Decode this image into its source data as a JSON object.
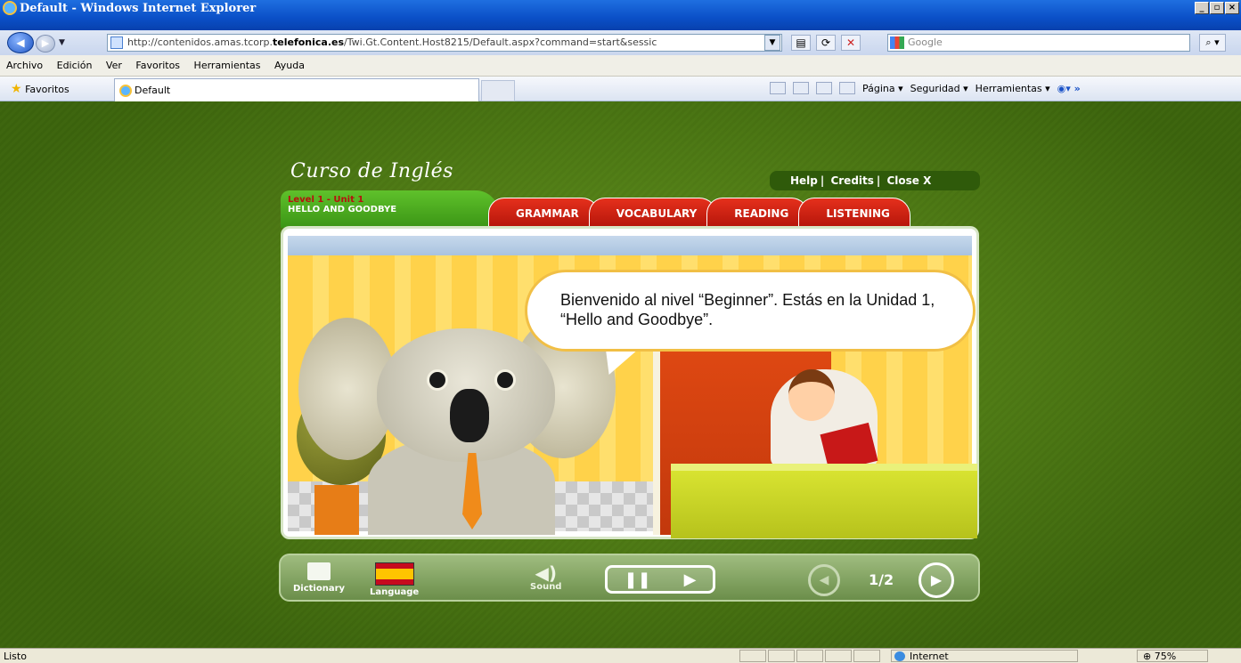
{
  "browser": {
    "title": "Default - Windows Internet Explorer",
    "address": "http://contenidos.amas.tcorp.",
    "address_domain": "telefonica.es",
    "address_path": "/Twi.Gt.Content.Host8215/Default.aspx?command=start&sessic",
    "search_placeholder": "Google",
    "menu": [
      "Archivo",
      "Edición",
      "Ver",
      "Favoritos",
      "Herramientas",
      "Ayuda"
    ],
    "favorites_label": "Favoritos",
    "tab_label": "Default",
    "cmd_pagina": "Página ▾",
    "cmd_seguridad": "Seguridad ▾",
    "cmd_herramientas": "Herramientas ▾",
    "status_text": "Listo",
    "zone_text": "Internet",
    "zoom_text": "75%"
  },
  "course": {
    "title": "Curso de Inglés",
    "links": {
      "help": "Help",
      "credits": "Credits",
      "close": "Close X"
    },
    "level": "Level 1 - Unit 1",
    "unit_title": "HELLO AND GOODBYE",
    "tabs": [
      "GRAMMAR",
      "VOCABULARY",
      "READING",
      "LISTENING"
    ],
    "bubble_text": "Bienvenido al nivel “Beginner”. Estás en la Unidad 1, “Hello and Goodbye”."
  },
  "controls": {
    "dictionary": "Dictionary",
    "language": "Language",
    "sound": "Sound",
    "page": "1/2"
  }
}
